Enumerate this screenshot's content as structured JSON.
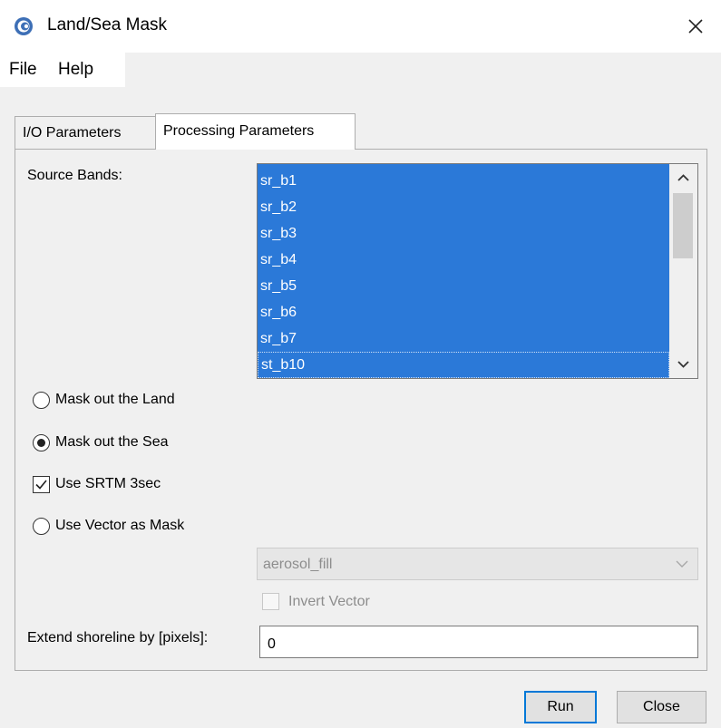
{
  "window": {
    "title": "Land/Sea Mask",
    "icon": "app-logo-icon",
    "close_icon": "close-icon"
  },
  "menu": {
    "items": [
      "File",
      "Help"
    ]
  },
  "tabs": [
    {
      "label": "I/O Parameters",
      "active": false
    },
    {
      "label": "Processing Parameters",
      "active": true
    }
  ],
  "source_bands": {
    "label": "Source Bands:",
    "items": [
      "sr_b1",
      "sr_b2",
      "sr_b3",
      "sr_b4",
      "sr_b5",
      "sr_b6",
      "sr_b7",
      "st_b10"
    ],
    "selection_color": "#2b79d8"
  },
  "options": {
    "mask_land": {
      "label": "Mask out the Land",
      "checked": false
    },
    "mask_sea": {
      "label": "Mask out the Sea",
      "checked": true
    },
    "use_srtm": {
      "label": "Use SRTM 3sec",
      "checked": true
    },
    "use_vector": {
      "label": "Use Vector as Mask",
      "checked": false
    }
  },
  "vector_select": {
    "value": "aerosol_fill",
    "enabled": false
  },
  "invert_vector": {
    "label": "Invert Vector",
    "checked": false,
    "enabled": false
  },
  "shoreline": {
    "label": "Extend shoreline by [pixels]:",
    "value": "0"
  },
  "buttons": {
    "run": "Run",
    "close": "Close"
  }
}
